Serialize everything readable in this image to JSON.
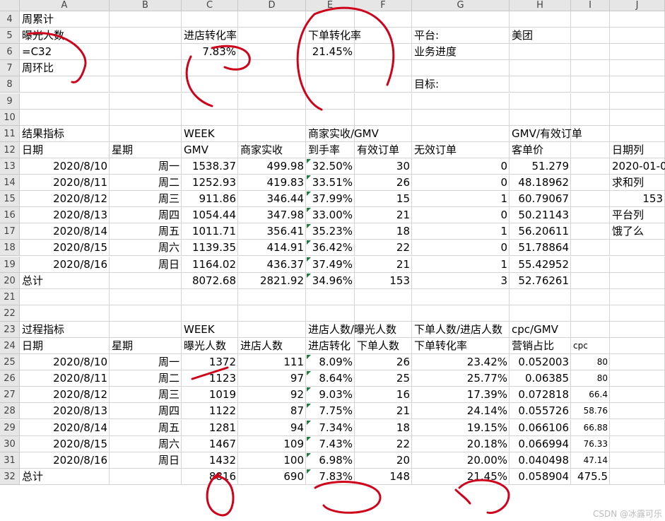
{
  "columns": [
    "A",
    "B",
    "C",
    "D",
    "E",
    "F",
    "G",
    "H",
    "I",
    "J"
  ],
  "rows": [
    "4",
    "5",
    "6",
    "7",
    "8",
    "9",
    "10",
    "11",
    "12",
    "13",
    "14",
    "15",
    "16",
    "17",
    "18",
    "19",
    "20",
    "21",
    "22",
    "23",
    "24",
    "25",
    "26",
    "27",
    "28",
    "29",
    "30",
    "31",
    "32"
  ],
  "top": {
    "a4": "周累计",
    "a5": "曝光人数",
    "a6": "=C32",
    "a7": "周环比",
    "c5": "进店转化率",
    "c6": "7.83%",
    "e5": "下单转化率",
    "e6": "21.45%",
    "g5": "平台:",
    "h5": "美团",
    "g6": "业务进度",
    "g8": "目标:"
  },
  "result": {
    "title": "结果指标",
    "week": "WEEK",
    "gmv_group": "商家实收/GMV",
    "order_group": "GMV/有效订单",
    "headers": [
      "日期",
      "星期",
      "GMV",
      "商家实收",
      "到手率",
      "有效订单",
      "无效订单",
      "客单价"
    ],
    "rows": [
      [
        "2020/8/10",
        "周一",
        "1538.37",
        "499.98",
        "32.50%",
        "30",
        "0",
        "51.279"
      ],
      [
        "2020/8/11",
        "周二",
        "1252.93",
        "419.83",
        "33.51%",
        "26",
        "0",
        "48.18962"
      ],
      [
        "2020/8/12",
        "周三",
        "911.86",
        "346.44",
        "37.99%",
        "15",
        "1",
        "60.79067"
      ],
      [
        "2020/8/13",
        "周四",
        "1054.44",
        "347.98",
        "33.00%",
        "21",
        "0",
        "50.21143"
      ],
      [
        "2020/8/14",
        "周五",
        "1011.71",
        "356.41",
        "35.23%",
        "18",
        "1",
        "56.20611"
      ],
      [
        "2020/8/15",
        "周六",
        "1139.35",
        "414.91",
        "36.42%",
        "22",
        "0",
        "51.78864"
      ],
      [
        "2020/8/16",
        "周日",
        "1164.02",
        "436.37",
        "37.49%",
        "21",
        "1",
        "55.42952"
      ]
    ],
    "total": [
      "总计",
      "",
      "8072.68",
      "2821.92",
      "34.96%",
      "153",
      "3",
      "52.76261"
    ]
  },
  "side": {
    "j12": "日期列",
    "j13": "2020-01-0",
    "j14": "求和列",
    "j15": "153",
    "j16": "平台列",
    "j17": "饿了么"
  },
  "process": {
    "title": "过程指标",
    "week": "WEEK",
    "group1": "进店人数/曝光人数",
    "group2": "下单人数/进店人数",
    "group3": "cpc/GMV",
    "headers": [
      "日期",
      "星期",
      "曝光人数",
      "进店人数",
      "进店转化",
      "下单人数",
      "下单转化率",
      "营销占比",
      "cpc"
    ],
    "rows": [
      [
        "2020/8/10",
        "周一",
        "1372",
        "111",
        "8.09%",
        "26",
        "23.42%",
        "0.052003",
        "80"
      ],
      [
        "2020/8/11",
        "周二",
        "1123",
        "97",
        "8.64%",
        "25",
        "25.77%",
        "0.06385",
        "80"
      ],
      [
        "2020/8/12",
        "周三",
        "1019",
        "92",
        "9.03%",
        "16",
        "17.39%",
        "0.072818",
        "66.4"
      ],
      [
        "2020/8/13",
        "周四",
        "1122",
        "87",
        "7.75%",
        "21",
        "24.14%",
        "0.055726",
        "58.76"
      ],
      [
        "2020/8/14",
        "周五",
        "1281",
        "94",
        "7.34%",
        "18",
        "19.15%",
        "0.066106",
        "66.88"
      ],
      [
        "2020/8/15",
        "周六",
        "1467",
        "109",
        "7.43%",
        "22",
        "20.18%",
        "0.066994",
        "76.33"
      ],
      [
        "2020/8/16",
        "周日",
        "1432",
        "100",
        "6.98%",
        "20",
        "20.00%",
        "0.040498",
        "47.14"
      ]
    ],
    "total": [
      "总计",
      "",
      "8816",
      "690",
      "7.83%",
      "148",
      "21.45%",
      "0.058904",
      "475.5"
    ]
  },
  "watermark": "CSDN @冰露可乐",
  "colors": {
    "ink": "#d0021b",
    "grid": "#d4d4d4",
    "header_bg": "#e6e6e6",
    "triangle": "#1f7a3a"
  }
}
